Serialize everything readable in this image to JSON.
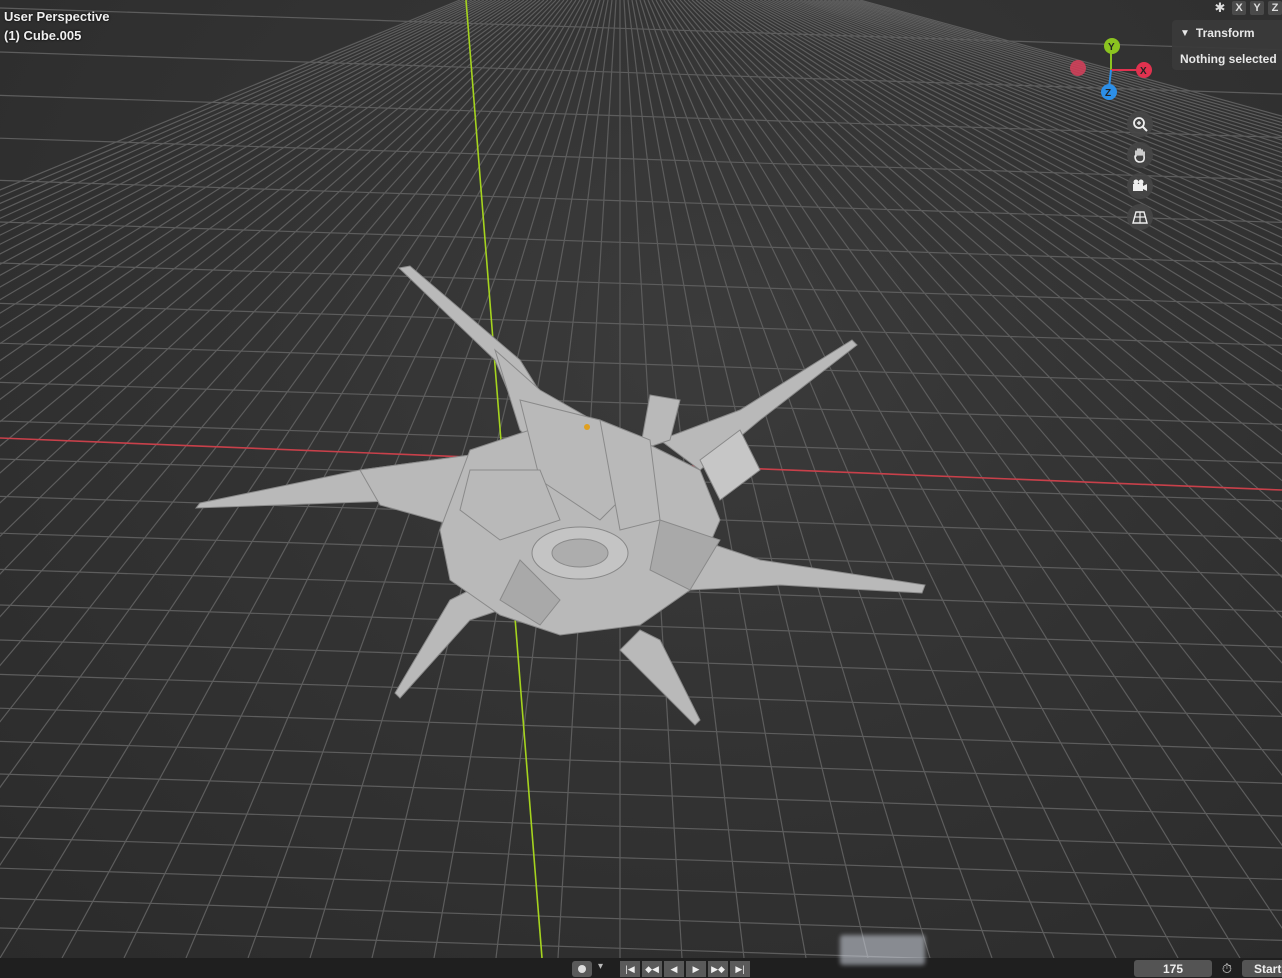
{
  "viewport": {
    "view_name": "User Perspective",
    "object_name": "(1) Cube.005"
  },
  "header": {
    "snap_icon": "snap-icon",
    "axis_buttons": [
      "X",
      "Y",
      "Z"
    ]
  },
  "n_panel": {
    "section_title": "Transform",
    "status": "Nothing selected"
  },
  "gizmo": {
    "labels": [
      "Y",
      "X",
      "Z"
    ],
    "colors": {
      "x": "#e0324f",
      "y": "#8bc320",
      "z": "#2c8fe8"
    }
  },
  "nav_buttons": [
    "zoom-icon",
    "hand-pan-icon",
    "camera-icon",
    "perspective-grid-icon"
  ],
  "timeline": {
    "current_frame": "175",
    "start_label": "Start"
  },
  "colors": {
    "viewport_bg": "#333333",
    "grid": "#5a5a5a",
    "x_axis": "#c8404a",
    "y_axis": "#a0d020"
  }
}
